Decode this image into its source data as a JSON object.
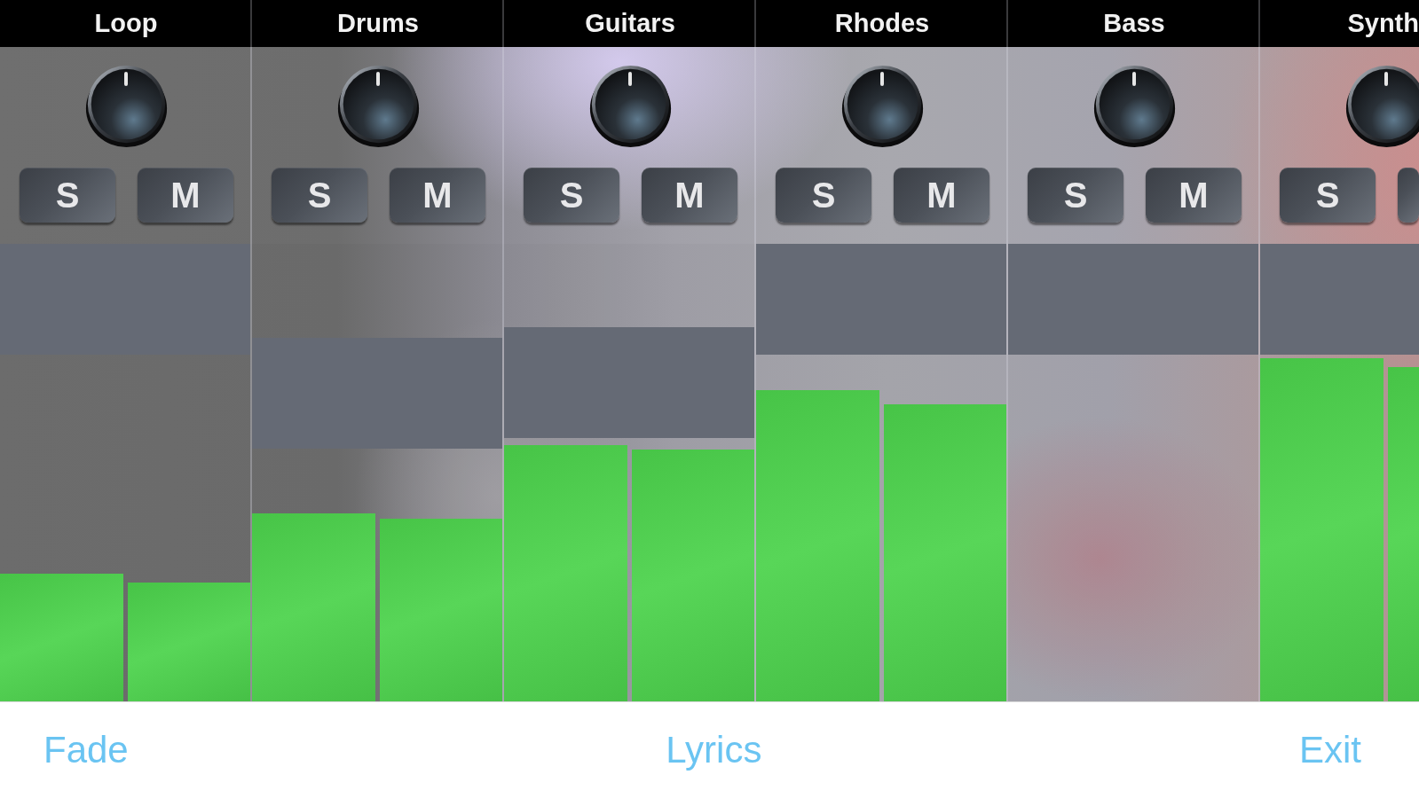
{
  "channels": [
    {
      "name": "Loop",
      "knob": {
        "level": 0.5
      },
      "solo": {
        "label": "S",
        "on": false
      },
      "mute": {
        "label": "M",
        "on": false
      },
      "fader": {
        "level": 1
      },
      "meters": [
        {
          "level": 0.28
        },
        {
          "level": 0.26
        }
      ]
    },
    {
      "name": "Drums",
      "knob": {
        "level": 0.5
      },
      "solo": {
        "label": "S",
        "on": false
      },
      "mute": {
        "label": "M",
        "on": false
      },
      "fader": {
        "level": 0.73
      },
      "meters": [
        {
          "level": 0.41
        },
        {
          "level": 0.4
        }
      ]
    },
    {
      "name": "Guitars",
      "knob": {
        "level": 0.5
      },
      "solo": {
        "label": "S",
        "on": false
      },
      "mute": {
        "label": "M",
        "on": false
      },
      "fader": {
        "level": 0.76
      },
      "meters": [
        {
          "level": 0.56
        },
        {
          "level": 0.55
        }
      ]
    },
    {
      "name": "Rhodes",
      "knob": {
        "level": 0.5
      },
      "solo": {
        "label": "S",
        "on": false
      },
      "mute": {
        "label": "M",
        "on": false
      },
      "fader": {
        "level": 1
      },
      "meters": [
        {
          "level": 0.68
        },
        {
          "level": 0.65
        }
      ]
    },
    {
      "name": "Bass",
      "knob": {
        "level": 0.5
      },
      "solo": {
        "label": "S",
        "on": false
      },
      "mute": {
        "label": "M",
        "on": false
      },
      "fader": {
        "level": 1
      }
    },
    {
      "name": "Synth",
      "knob": {
        "level": 0.5
      },
      "solo": {
        "label": "S",
        "on": false
      },
      "mute": {
        "on": false
      },
      "fader": {
        "level": 1
      },
      "meters": [
        {
          "level": 0.75
        },
        {
          "level": 0.73
        }
      ]
    }
  ],
  "toolbar": [
    "Fade",
    "Lyrics",
    "Exit"
  ]
}
